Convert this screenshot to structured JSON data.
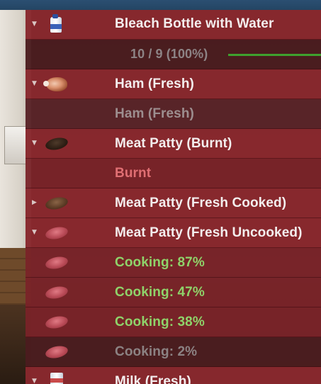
{
  "inventory": {
    "rows": [
      {
        "type": "header",
        "arrow": "▼",
        "icon": "bleach-bottle-icon",
        "label": "Bleach Bottle with Water"
      },
      {
        "type": "sub",
        "label": "10 / 9 (100%)",
        "fill_level": 1.0
      },
      {
        "type": "header",
        "arrow": "▼",
        "icon": "ham-icon",
        "label": "Ham (Fresh)"
      },
      {
        "type": "sub",
        "label": "Ham (Fresh)"
      },
      {
        "type": "header",
        "arrow": "▼",
        "icon": "meat-patty-burnt-icon",
        "label": "Meat Patty (Burnt)"
      },
      {
        "type": "sub",
        "label": "Burnt"
      },
      {
        "type": "header",
        "arrow": "▶",
        "icon": "meat-patty-cooked-icon",
        "label": "Meat Patty (Fresh Cooked)"
      },
      {
        "type": "header",
        "arrow": "▼",
        "icon": "meat-patty-raw-icon",
        "label": "Meat Patty (Fresh Uncooked)"
      },
      {
        "type": "sub",
        "icon": "meat-patty-raw-icon",
        "label": "Cooking: 87%"
      },
      {
        "type": "sub",
        "icon": "meat-patty-raw-icon",
        "label": "Cooking: 47%"
      },
      {
        "type": "sub",
        "icon": "meat-patty-raw-icon",
        "label": "Cooking: 38%"
      },
      {
        "type": "sub",
        "icon": "meat-patty-raw-icon",
        "label": "Cooking: 2%"
      },
      {
        "type": "header",
        "arrow": "▼",
        "icon": "milk-carton-icon",
        "label": "Milk (Fresh)"
      }
    ]
  },
  "colors": {
    "header_text": "#f3eeee",
    "cooking_text": "#8fd36a",
    "burnt_text": "#e06f73",
    "dim_text": "#9d8e8f",
    "progress": "#3fa12e",
    "panel": "#8a282e"
  }
}
